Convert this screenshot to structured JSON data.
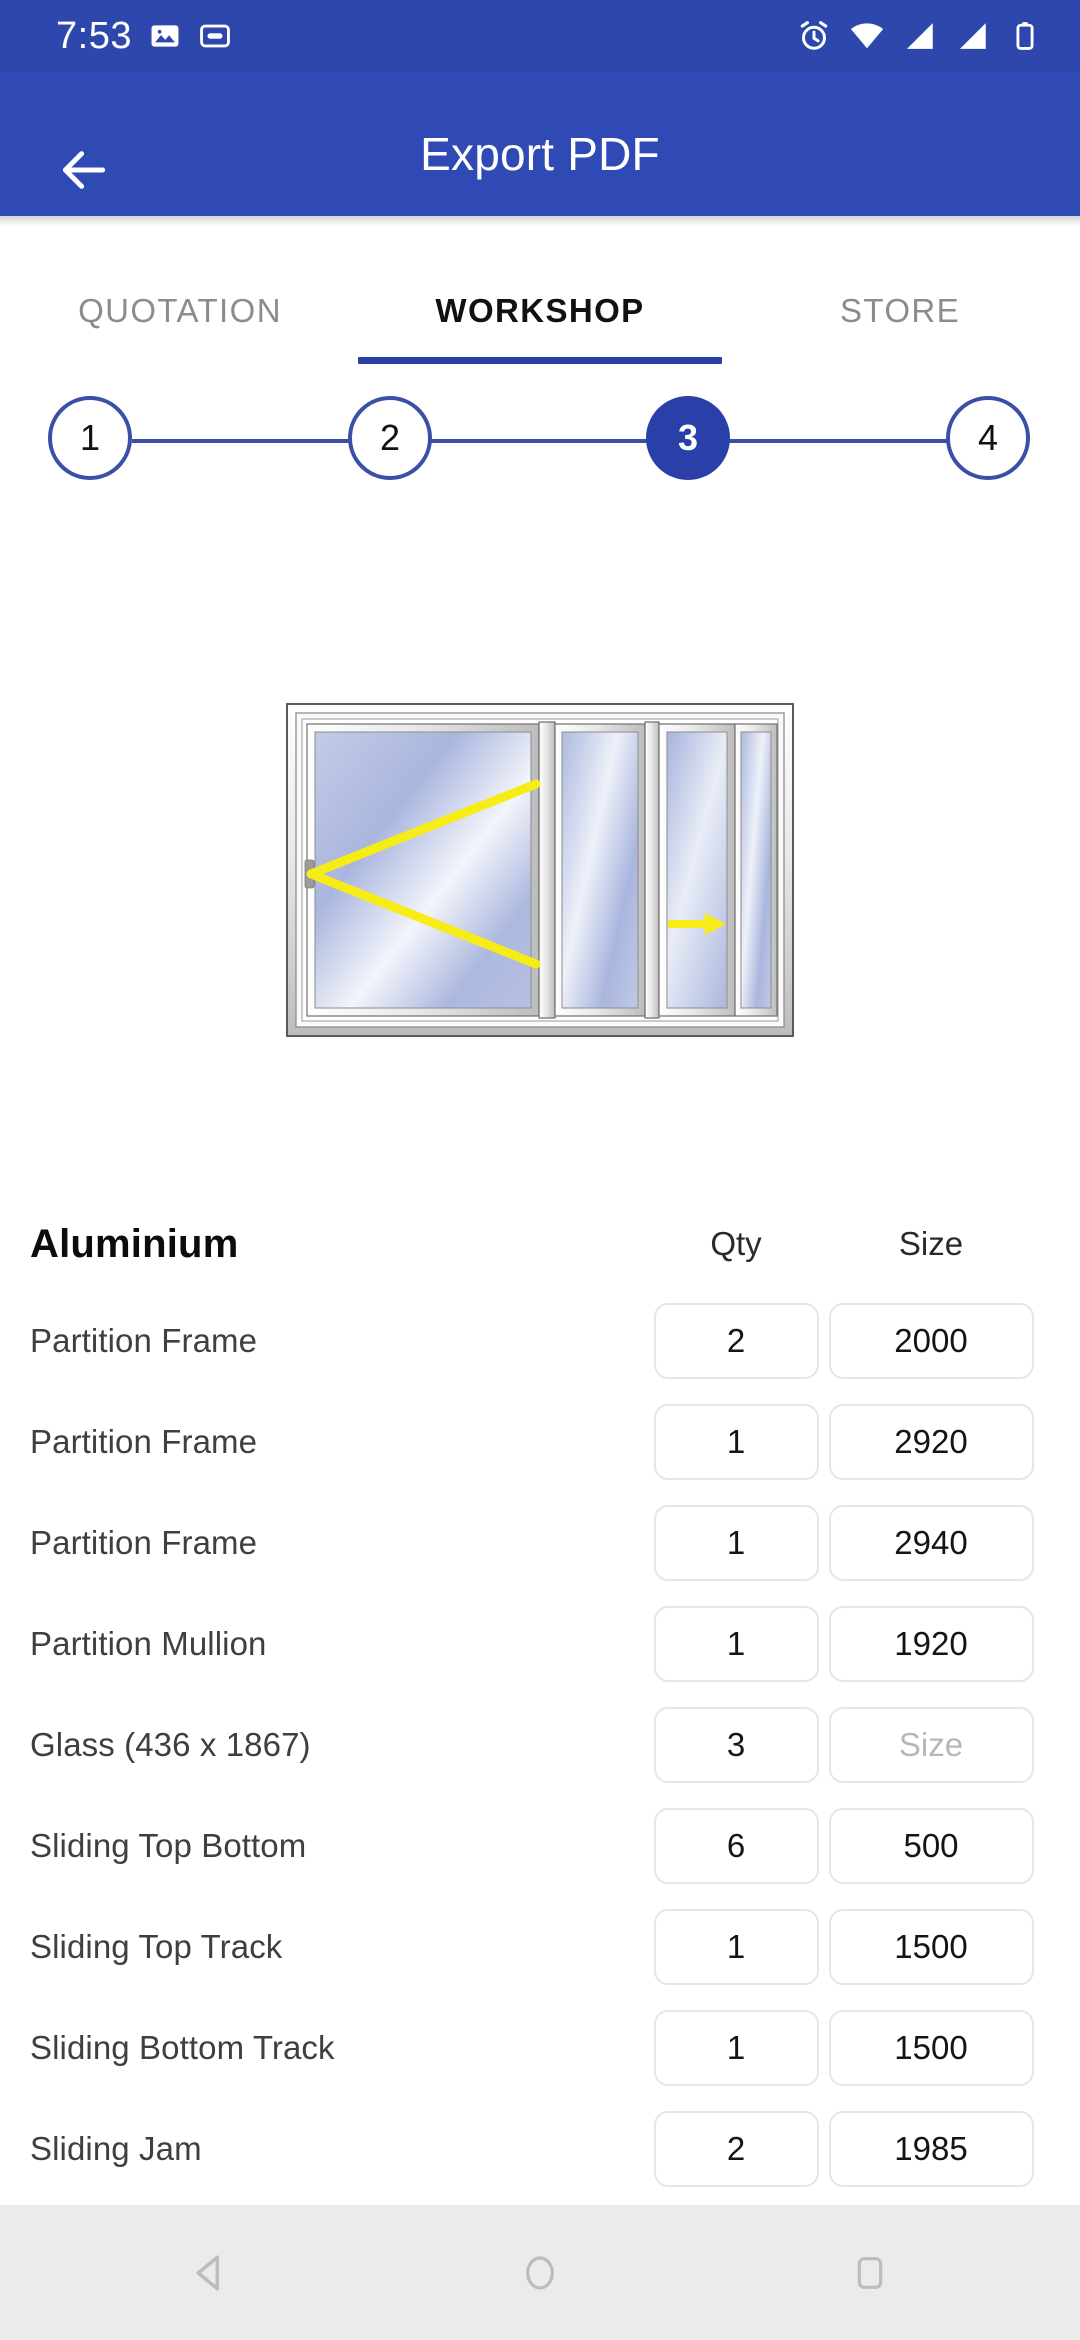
{
  "status_bar": {
    "time": "7:53",
    "left_icons": [
      "image-icon",
      "caption-icon"
    ],
    "right_icons": [
      "alarm-icon",
      "wifi-icon",
      "signal-icon",
      "signal-icon-2",
      "battery-icon"
    ]
  },
  "app_bar": {
    "title": "Export PDF",
    "back_icon": "arrow-left-icon",
    "background_color": "#2b3fa8",
    "accent_color": "#2f4ab5"
  },
  "tabs": {
    "items": [
      {
        "label": "QUOTATION",
        "active": false
      },
      {
        "label": "WORKSHOP",
        "active": true
      },
      {
        "label": "STORE",
        "active": false
      }
    ],
    "indicator_color": "#2b3fa8"
  },
  "stepper": {
    "steps": [
      "1",
      "2",
      "3",
      "4"
    ],
    "active_index": 2,
    "line_color": "#3a4fa5",
    "active_color": "#2b3fa8"
  },
  "diagram": {
    "name": "sliding-partition-window-diagram",
    "panels": 4,
    "glass_color": "#a8b4dd",
    "frame_color": "#f2f2f2",
    "marker_color": "#f7ec16",
    "markers": [
      "hinge-open-direction",
      "slide-right-arrow"
    ]
  },
  "table": {
    "headers": {
      "material": "Aluminium",
      "qty": "Qty",
      "size": "Size"
    },
    "size_placeholder": "Size",
    "rows": [
      {
        "label": "Partition Frame",
        "qty": "2",
        "size": "2000"
      },
      {
        "label": "Partition Frame",
        "qty": "1",
        "size": "2920"
      },
      {
        "label": "Partition Frame",
        "qty": "1",
        "size": "2940"
      },
      {
        "label": "Partition Mullion",
        "qty": "1",
        "size": "1920"
      },
      {
        "label": "Glass (436 x 1867)",
        "qty": "3",
        "size": ""
      },
      {
        "label": "Sliding Top Bottom",
        "qty": "6",
        "size": "500"
      },
      {
        "label": "Sliding Top Track",
        "qty": "1",
        "size": "1500"
      },
      {
        "label": "Sliding Bottom Track",
        "qty": "1",
        "size": "1500"
      },
      {
        "label": "Sliding Jam",
        "qty": "2",
        "size": "1985"
      }
    ]
  },
  "nav_bar": {
    "buttons": [
      "back-triangle-icon",
      "home-circle-icon",
      "recents-square-icon"
    ],
    "background_color": "#ebebeb"
  }
}
